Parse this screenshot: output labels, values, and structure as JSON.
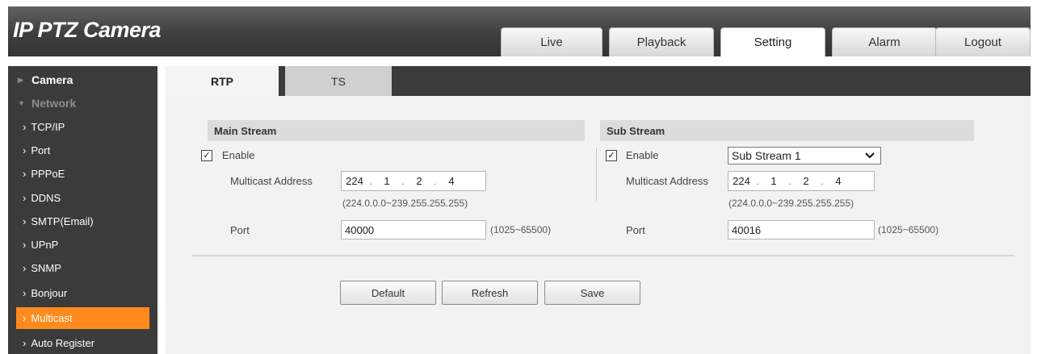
{
  "app": {
    "title": "IP PTZ Camera"
  },
  "nav_tabs": [
    "Live",
    "Playback",
    "Setting",
    "Alarm",
    "Logout"
  ],
  "sidebar": {
    "sections": [
      {
        "label": "Camera",
        "state": "collapsed"
      },
      {
        "label": "Network",
        "state": "expanded"
      }
    ],
    "items": [
      "TCP/IP",
      "Port",
      "PPPoE",
      "DDNS",
      "SMTP(Email)",
      "UPnP",
      "SNMP",
      "Bonjour",
      "Multicast",
      "Auto Register"
    ],
    "active_item": "Multicast"
  },
  "subtabs": {
    "rtp": "RTP",
    "ts": "TS"
  },
  "main_stream": {
    "header": "Main Stream",
    "enable_label": "Enable",
    "enabled": true,
    "address_label": "Multicast Address",
    "address": [
      "224",
      "1",
      "2",
      "4"
    ],
    "address_range": "(224.0.0.0~239.255.255.255)",
    "port_label": "Port",
    "port": "40000",
    "port_range": "(1025~65500)"
  },
  "sub_stream": {
    "header": "Sub Stream",
    "enable_label": "Enable",
    "enabled": true,
    "stream_select": "Sub Stream 1",
    "address_label": "Multicast Address",
    "address": [
      "224",
      "1",
      "2",
      "4"
    ],
    "address_range": "(224.0.0.0~239.255.255.255)",
    "port_label": "Port",
    "port": "40016",
    "port_range": "(1025~65500)"
  },
  "buttons": {
    "default": "Default",
    "refresh": "Refresh",
    "save": "Save"
  },
  "colors": {
    "accent": "#ff8a1e",
    "sidebar_bg": "#3b3b3b",
    "header_bg": "#4a4a4a"
  }
}
